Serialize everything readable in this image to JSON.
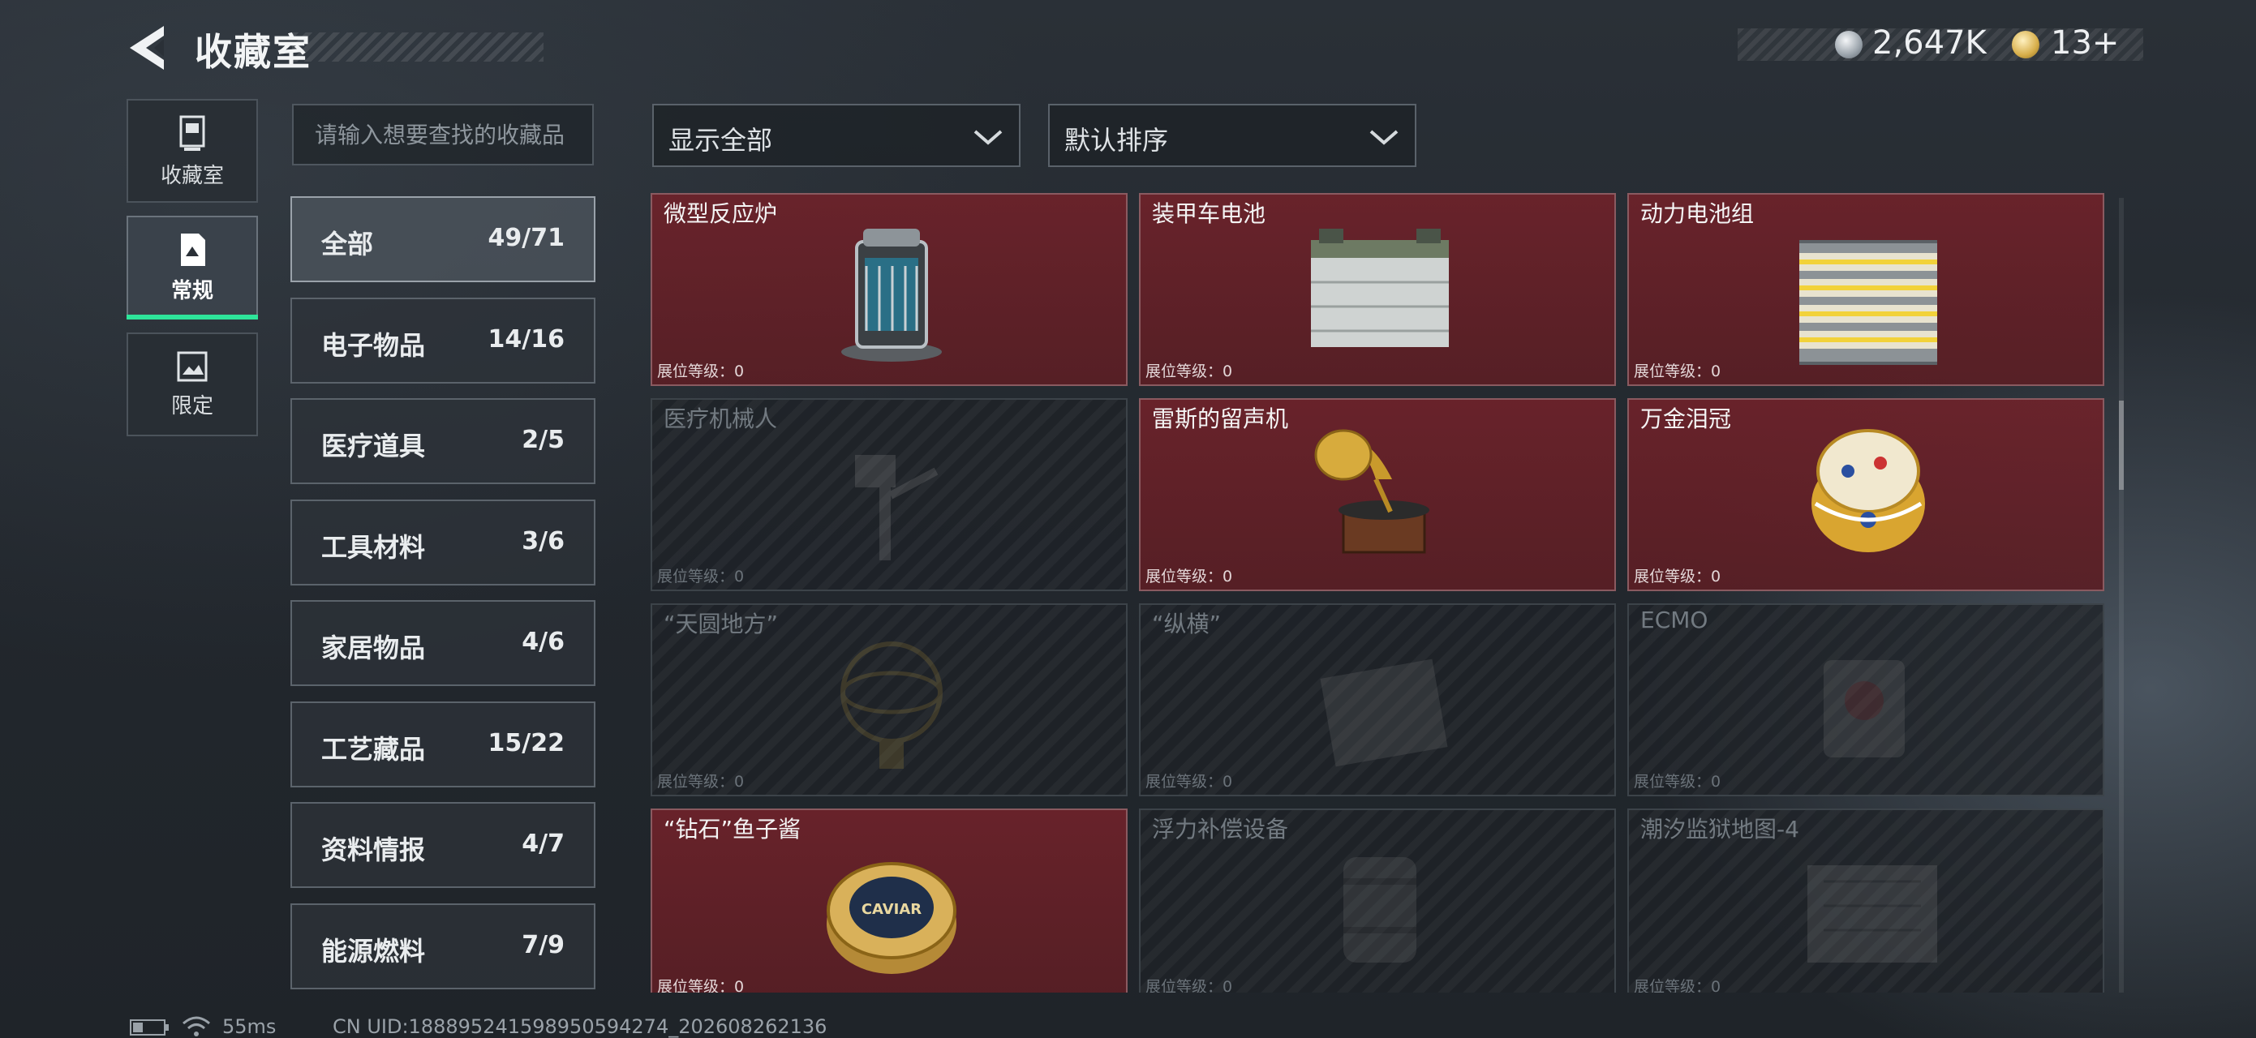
{
  "header": {
    "title": "收藏室",
    "currency_silver": "2,647K",
    "currency_gold": "13+"
  },
  "side_nav": [
    {
      "label": "收藏室",
      "icon": "trash-bin-icon",
      "active": false
    },
    {
      "label": "常规",
      "icon": "document-icon",
      "active": true
    },
    {
      "label": "限定",
      "icon": "picture-icon",
      "active": false
    }
  ],
  "search": {
    "placeholder": "请输入想要查找的收藏品"
  },
  "filter": {
    "value": "显示全部"
  },
  "sort": {
    "value": "默认排序"
  },
  "categories": [
    {
      "name": "全部",
      "count": "49/71",
      "active": true
    },
    {
      "name": "电子物品",
      "count": "14/16"
    },
    {
      "name": "医疗道具",
      "count": "2/5"
    },
    {
      "name": "工具材料",
      "count": "3/6"
    },
    {
      "name": "家居物品",
      "count": "4/6"
    },
    {
      "name": "工艺藏品",
      "count": "15/22"
    },
    {
      "name": "资料情报",
      "count": "4/7"
    },
    {
      "name": "能源燃料",
      "count": "7/9"
    }
  ],
  "items": [
    {
      "name": "微型反应炉",
      "level": "展位等级：0",
      "owned": true,
      "icon": "reactor-icon"
    },
    {
      "name": "装甲车电池",
      "level": "展位等级：0",
      "owned": true,
      "icon": "battery-icon"
    },
    {
      "name": "动力电池组",
      "level": "展位等级：0",
      "owned": true,
      "icon": "battery-pack-icon"
    },
    {
      "name": "医疗机械人",
      "level": "展位等级：0",
      "owned": false,
      "icon": "medical-robot-icon"
    },
    {
      "name": "雷斯的留声机",
      "level": "展位等级：0",
      "owned": true,
      "icon": "gramophone-icon"
    },
    {
      "name": "万金泪冠",
      "level": "展位等级：0",
      "owned": true,
      "icon": "jeweled-egg-icon"
    },
    {
      "name": "“天圆地方”",
      "level": "展位等级：0",
      "owned": false,
      "icon": "globe-icon"
    },
    {
      "name": "“纵横”",
      "level": "展位等级：0",
      "owned": false,
      "icon": "chessboard-icon"
    },
    {
      "name": "ECMO",
      "level": "展位等级：0",
      "owned": false,
      "icon": "ecmo-icon"
    },
    {
      "name": "“钻石”鱼子酱",
      "level": "展位等级：0",
      "owned": true,
      "icon": "caviar-tin-icon",
      "art_text": "CAVIAR"
    },
    {
      "name": "浮力补偿设备",
      "level": "展位等级：0",
      "owned": false,
      "icon": "buoyancy-device-icon"
    },
    {
      "name": "潮汐监狱地图-4",
      "level": "展位等级：0",
      "owned": false,
      "icon": "map-icon"
    }
  ],
  "status_bar": {
    "ping": "55ms",
    "uid": "CN UID:188895241598950594274_202608262136"
  },
  "colors": {
    "accent_green": "#2ee59a",
    "owned_card": "#6e2229",
    "locked_card": "#1e2227"
  }
}
